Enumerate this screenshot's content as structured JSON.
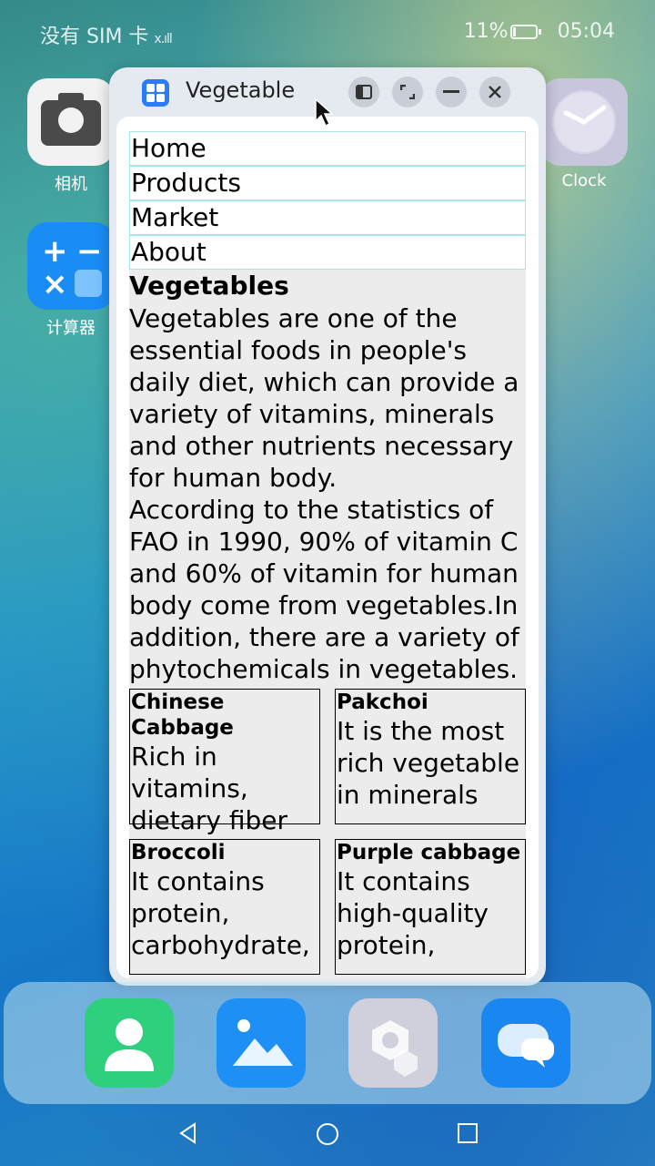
{
  "status_bar": {
    "carrier": "没有 SIM 卡",
    "battery": "11%",
    "time": "05:04"
  },
  "desktop": {
    "apps": [
      {
        "label": "相机",
        "icon": "camera-icon"
      },
      {
        "label": "计算器",
        "icon": "calculator-icon"
      },
      {
        "label": "Clock",
        "icon": "clock-icon"
      }
    ],
    "dock": [
      {
        "icon": "contacts-icon",
        "color": "#2ecf7d"
      },
      {
        "icon": "gallery-icon",
        "color": "#1d8ff5"
      },
      {
        "icon": "settings-icon",
        "color": "#cfd0dc"
      },
      {
        "icon": "messages-icon",
        "color": "#1a86f0"
      }
    ]
  },
  "window": {
    "title": "Vegetable",
    "buttons": [
      "split-screen-icon",
      "maximize-icon",
      "minimize-icon",
      "close-icon"
    ]
  },
  "page": {
    "nav": [
      "Home",
      "Products",
      "Market",
      "About"
    ],
    "heading": "Vegetables",
    "paragraphs": [
      "Vegetables are one of the essential foods in people's daily diet, which can provide a variety of vitamins, minerals and other nutrients necessary for human body.",
      "According to the statistics of FAO in 1990, 90% of vitamin C and 60% of vitamin for human body come from vegetables.In addition, there are a variety of phytochemicals in vegetables."
    ],
    "cards": [
      {
        "title": "Chinese Cabbage",
        "desc": "Rich in vitamins, dietary fiber"
      },
      {
        "title": "Pakchoi",
        "desc": "It is the most rich vegetable in minerals"
      },
      {
        "title": "Broccoli",
        "desc": "It contains protein, carbohydrate,"
      },
      {
        "title": "Purple cabbage",
        "desc": "It contains high-quality protein,"
      }
    ]
  },
  "colors": {
    "nav_border": "#a8e6e8",
    "page_bg": "#ececec",
    "window_bg": "#e4eaf0"
  }
}
